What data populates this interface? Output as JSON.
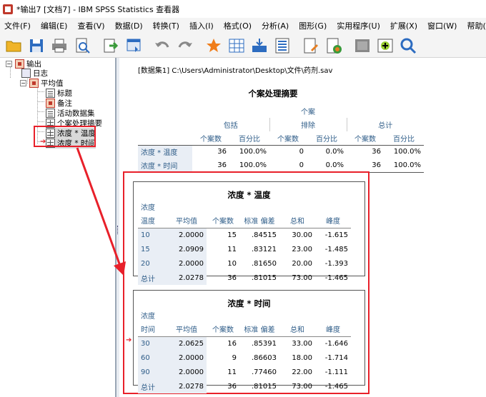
{
  "window": {
    "title": "*输出7 [文档7] - IBM SPSS Statistics 查看器"
  },
  "menu": [
    "文件(F)",
    "编辑(E)",
    "查看(V)",
    "数据(D)",
    "转换(T)",
    "插入(I)",
    "格式(O)",
    "分析(A)",
    "图形(G)",
    "实用程序(U)",
    "扩展(X)",
    "窗口(W)",
    "帮助(H)"
  ],
  "toolbar": [
    "open-folder-icon",
    "save-icon",
    "print-icon",
    "print-preview-icon",
    "export-icon",
    "recall-dialog-icon",
    "undo-icon",
    "redo-icon",
    "goto-data-icon",
    "goto-case-icon",
    "goto-variable-icon",
    "variables-icon",
    "insert-output-icon",
    "insert-chart-icon",
    "hide-icon",
    "show-icon",
    "find-icon"
  ],
  "tree": {
    "root": "输出",
    "log": "日志",
    "means": "平均值",
    "children": [
      "标题",
      "备注",
      "活动数据集",
      "个案处理摘要",
      "浓度 * 温度",
      "浓度 * 时间"
    ]
  },
  "content": {
    "path": "[数据集1] C:\\Users\\Administrator\\Desktop\\文件\\药剂.sav",
    "summary": {
      "title": "个案处理摘要",
      "group": "个案",
      "included": "包括",
      "excluded": "排除",
      "total": "总计",
      "n": "个案数",
      "pct": "百分比",
      "rows": [
        {
          "label": "浓度 * 温度",
          "v": [
            "36",
            "100.0%",
            "0",
            "0.0%",
            "36",
            "100.0%"
          ]
        },
        {
          "label": "浓度 * 时间",
          "v": [
            "36",
            "100.0%",
            "0",
            "0.0%",
            "36",
            "100.0%"
          ]
        }
      ]
    },
    "temp": {
      "title": "浓度 * 温度",
      "dep": "浓度",
      "var": "温度",
      "cols": [
        "平均值",
        "个案数",
        "标准 偏差",
        "总和",
        "峰度"
      ],
      "rows": [
        [
          "10",
          "2.0000",
          "15",
          ".84515",
          "30.00",
          "-1.615"
        ],
        [
          "15",
          "2.0909",
          "11",
          ".83121",
          "23.00",
          "-1.485"
        ],
        [
          "20",
          "2.0000",
          "10",
          ".81650",
          "20.00",
          "-1.393"
        ],
        [
          "总计",
          "2.0278",
          "36",
          ".81015",
          "73.00",
          "-1.465"
        ]
      ]
    },
    "time": {
      "title": "浓度 * 时间",
      "dep": "浓度",
      "var": "时间",
      "cols": [
        "平均值",
        "个案数",
        "标准 偏差",
        "总和",
        "峰度"
      ],
      "rows": [
        [
          "30",
          "2.0625",
          "16",
          ".85391",
          "33.00",
          "-1.646"
        ],
        [
          "60",
          "2.0000",
          "9",
          ".86603",
          "18.00",
          "-1.714"
        ],
        [
          "90",
          "2.0000",
          "11",
          ".77460",
          "22.00",
          "-1.111"
        ],
        [
          "总计",
          "2.0278",
          "36",
          ".81015",
          "73.00",
          "-1.465"
        ]
      ]
    }
  },
  "colors": {
    "highlight": "#e8202a",
    "header_text": "#2e5c88",
    "row_shade": "#e9eef5"
  }
}
